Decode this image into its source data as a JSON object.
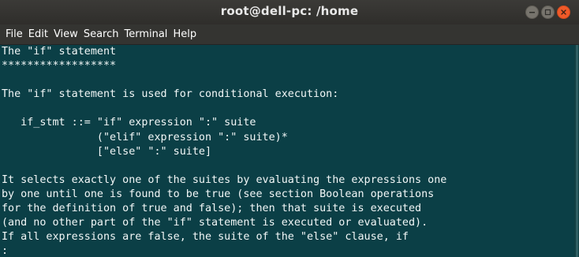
{
  "window": {
    "title": "root@dell-pc: /home"
  },
  "menu": [
    "File",
    "Edit",
    "View",
    "Search",
    "Terminal",
    "Help"
  ],
  "terminal": {
    "lines": [
      "The \"if\" statement",
      "******************",
      "",
      "The \"if\" statement is used for conditional execution:",
      "",
      "   if_stmt ::= \"if\" expression \":\" suite",
      "               (\"elif\" expression \":\" suite)*",
      "               [\"else\" \":\" suite]",
      "",
      "It selects exactly one of the suites by evaluating the expressions one",
      "by one until one is found to be true (see section Boolean operations",
      "for the definition of true and false); then that suite is executed",
      "(and no other part of the \"if\" statement is executed or evaluated).",
      "If all expressions are false, the suite of the \"else\" clause, if",
      ":"
    ]
  },
  "colors": {
    "terminal_background": "#0b3f46",
    "terminal_text": "#f2f7f7",
    "close_button": "#f05a29"
  },
  "icons": {
    "minimize": "minimize-icon",
    "maximize": "maximize-icon",
    "close": "close-icon"
  }
}
